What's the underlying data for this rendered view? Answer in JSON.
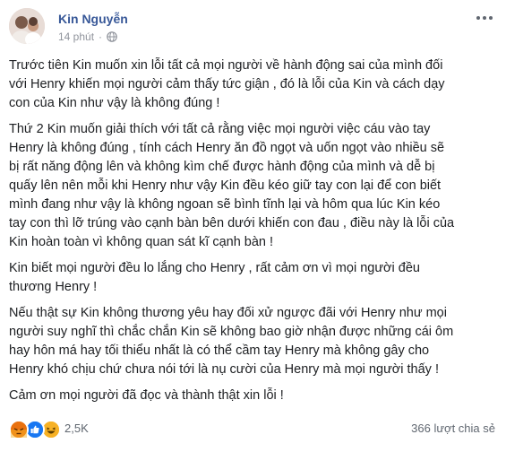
{
  "post": {
    "author": "Kin Nguyễn",
    "time": "14 phút",
    "separator": "·",
    "privacy_icon": "globe-icon"
  },
  "content": {
    "paragraphs": [
      {
        "lines": [
          "Trước tiên Kin muốn xin lỗi tất cả mọi người về hành động sai của mình đối",
          "với Henry khiến mọi người cảm thấy tức giận , đó là lỗi của Kin và cách dạy",
          "con của Kin như vậy là không đúng !"
        ]
      },
      {
        "lines": [
          "Thứ 2 Kin muốn giải thích với tất cả rằng việc mọi người việc cáu vào tay",
          "Henry là không đúng , tính cách Henry ăn đồ ngọt và uốn ngọt vào nhiều sẽ",
          "bị rất năng động lên và không kìm chế được hành động của mình và dễ bị",
          "quấy lên nên mỗi khi Henry như vậy Kin đều kéo giữ tay con lại để con biết",
          "mình đang như vậy là không ngoan sẽ bình tĩnh lại và hôm qua lúc Kin kéo",
          "tay con thì lỡ trúng vào cạnh bàn bên dưới khiến con đau , điều này là lỗi của",
          "Kin hoàn toàn vì không quan sát kĩ cạnh bàn !"
        ]
      },
      {
        "lines": [
          "Kin biết mọi người đều lo lắng cho Henry , rất cảm ơn vì mọi người đều",
          "thương Henry !"
        ]
      },
      {
        "lines": [
          "Nếu thật sự Kin không thương yêu hay đối xử ngược đãi với Henry như mọi",
          "người suy nghĩ thì chắc chắn Kin sẽ không bao giờ nhận được những cái ôm",
          "hay hôn má hay tối thiểu nhất là có thể cầm tay Henry mà không gây cho",
          "Henry khó chịu chứ chưa nói tới là nụ cười của Henry mà mọi người thấy !"
        ]
      },
      {
        "lines": [
          "Cảm ơn mọi người đã đọc và thành thật xin lỗi !"
        ]
      }
    ]
  },
  "footer": {
    "reactions": [
      "angry-icon",
      "like-icon",
      "haha-icon"
    ],
    "reaction_count": "2,5K",
    "shares": "366 lượt chia sẻ"
  },
  "colors": {
    "author": "#385898",
    "meta": "#90949c",
    "text": "#1c1e21",
    "like": "#1877f2",
    "angry": "#e9710f",
    "haha": "#f7b125"
  }
}
